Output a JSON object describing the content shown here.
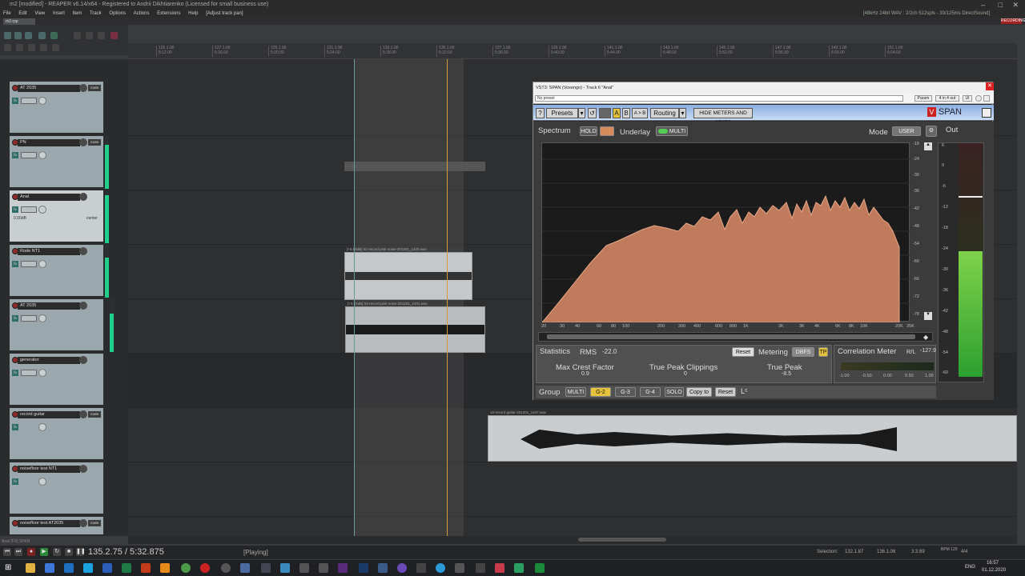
{
  "window": {
    "title": "m2 [modified] - REAPER v6.14/x64 - Registered to Andrii Dikhtiarenko (Licensed for small business use)",
    "status": "[48kHz 24bit WAV : 2/2ch 512spls - 39/125ms DirectSound]"
  },
  "menu": {
    "items": [
      "File",
      "Edit",
      "View",
      "Insert",
      "Item",
      "Track",
      "Options",
      "Actions",
      "Extensions",
      "Help",
      "[Adjust track pan]"
    ]
  },
  "project_tab": {
    "label": "m2.rpp",
    "recording_label": "RECORDING"
  },
  "ruler": {
    "ticks": [
      "125.1.00",
      "127.1.00",
      "129.1.00",
      "131.1.00",
      "133.1.00",
      "135.1.00",
      "137.1.00",
      "139.1.00",
      "141.1.00",
      "143.1.00",
      "145.1.00",
      "147.1.00",
      "149.1.00",
      "151.1.00"
    ],
    "times": [
      "5:12.00",
      "5:16.00",
      "5:20.00",
      "5:24.00",
      "5:28.00",
      "5:32.00",
      "5:36.00",
      "5:40.00",
      "5:44.00",
      "5:48.00",
      "5:52.00",
      "5:56.00",
      "6:00.00",
      "6:04.00"
    ]
  },
  "tracks": [
    {
      "name": "AT 2035",
      "route": "route"
    },
    {
      "name": "PN",
      "route": "route"
    },
    {
      "name": "Anal",
      "route": "route",
      "volume": "0.00dB",
      "pan": "center"
    },
    {
      "name": "Rode NT1",
      "route": "route"
    },
    {
      "name": "AT 2035",
      "route": "route"
    },
    {
      "name": "generator",
      "route": "route"
    },
    {
      "name": "record guitar",
      "route": "route"
    },
    {
      "name": "noisefloor test NT1",
      "route": "route"
    },
    {
      "name": "noisefloor test AT2035",
      "route": "route"
    }
  ],
  "items": {
    "pink1": "[+5.58dB] 02-record pink noise-201201_1430.wav",
    "pink2": "[+3.01dB] 02-record pink noise-201201_1431.wav",
    "guitar": "10-record guitar-201201_1447.wav"
  },
  "plugin": {
    "title": "VST3: SPAN (Voxengo) - Track 6 \"Anal\"",
    "preset_field": "No preset",
    "param": "Param",
    "io": "4 in 4 out",
    "ui": "UI",
    "toolbar": {
      "help": "?",
      "presets": "Presets",
      "a": "A",
      "b": "B",
      "ab": "A > B",
      "routing": "Routing",
      "hide": "HIDE METERS AND STATS",
      "logo": "SPAN"
    },
    "top": {
      "spectrum": "Spectrum",
      "hold": "HOLD",
      "underlay": "Underlay",
      "multi": "MULTI",
      "mode": "Mode",
      "mode_value": "USER",
      "out": "Out"
    },
    "db_scale": [
      "-18",
      "-24",
      "-30",
      "-36",
      "-42",
      "-48",
      "-54",
      "-60",
      "-66",
      "-72",
      "-78"
    ],
    "freq_scale": [
      "20",
      "30",
      "40",
      "60",
      "80",
      "100",
      "200",
      "300",
      "400",
      "600",
      "800",
      "1K",
      "2K",
      "3K",
      "4K",
      "6K",
      "8K",
      "10K",
      "20K",
      "25K"
    ],
    "out_scale": [
      "6",
      "0",
      "-6",
      "-12",
      "-18",
      "-24",
      "-30",
      "-36",
      "-42",
      "-48",
      "-54",
      "-60"
    ],
    "out_level": 0.55,
    "stats": {
      "title": "Statistics",
      "rms_label": "RMS",
      "rms_value": "-22.0",
      "reset": "Reset",
      "metering": "Metering",
      "metering_mode": "DBFS",
      "tp": "TP",
      "crest_label": "Max Crest Factor",
      "crest_value": "0.9",
      "clip_label": "True Peak Clippings",
      "clip_value": "0",
      "tpeak_label": "True Peak",
      "tpeak_value": "-8.5"
    },
    "corr": {
      "title": "Correlation Meter",
      "mode": "R/L",
      "value": "-127.9",
      "scale": [
        "-1.00",
        "-0.50",
        "0.00",
        "0.50",
        "1.00"
      ]
    },
    "group": {
      "label": "Group",
      "multi": "MULTI",
      "g2": "G-2",
      "g3": "G-3",
      "g4": "G-4",
      "solo": "SOLO",
      "copy": "Copy to",
      "reset": "Reset",
      "lc": "Lᶜ"
    }
  },
  "transport": {
    "position": "135.2.75 / 5:32.875",
    "state": "[Playing]",
    "selection_label": "Selection:",
    "sel_start": "132.1.87",
    "sel_end": "136.1.06",
    "sel_len": "3.3.69",
    "bpm": "BPM 120",
    "sig": "4/4"
  },
  "taskbar": {
    "lang": "ENG",
    "time": "16:57",
    "date": "01.12.2020"
  },
  "status_left": "Anal [FX] SPAN"
}
